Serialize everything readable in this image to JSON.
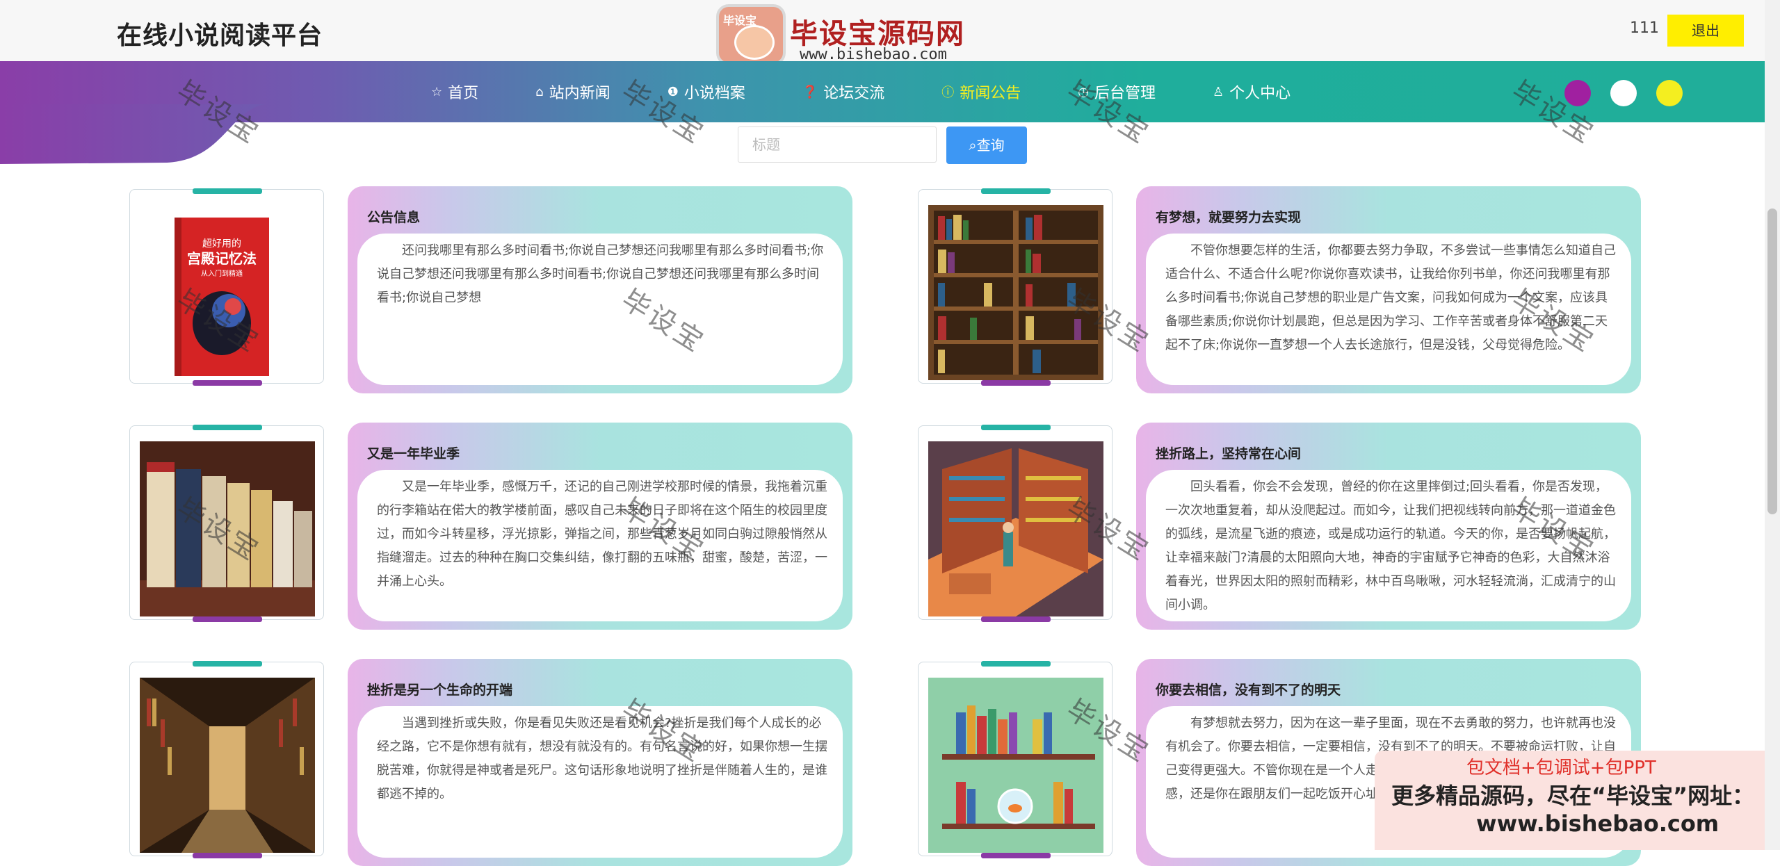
{
  "header": {
    "site_title": "在线小说阅读平台",
    "username": "111",
    "logout_label": "退出"
  },
  "watermark": {
    "badge_text": "毕设宝",
    "logo_text": "毕设宝源码网",
    "logo_url": "www.bishebao.com",
    "diagonal_text": "毕设宝"
  },
  "nav": {
    "items": [
      {
        "label": "首页",
        "icon": "star-icon"
      },
      {
        "label": "站内新闻",
        "icon": "bag-icon"
      },
      {
        "label": "小说档案",
        "icon": "info-icon"
      },
      {
        "label": "论坛交流",
        "icon": "question-icon"
      },
      {
        "label": "新闻公告",
        "icon": "info-icon",
        "active": true
      },
      {
        "label": "后台管理",
        "icon": "clock-icon"
      },
      {
        "label": "个人中心",
        "icon": "user-icon"
      }
    ],
    "theme_dots": [
      "#a020a0",
      "#ffffff",
      "#f4ee20"
    ]
  },
  "search": {
    "placeholder": "标题",
    "button_label": "查询"
  },
  "cards": [
    {
      "title": "公告信息",
      "content": "还问我哪里有那么多时间看书;你说自己梦想还问我哪里有那么多时间看书;你说自己梦想还问我哪里有那么多时间看书;你说自己梦想还问我哪里有那么多时间看书;你说自己梦想",
      "image": "book-cover-palace-memory",
      "image_caption": "超好用的 宫殿记忆法 从入门到精通"
    },
    {
      "title": "有梦想，就要努力去实现",
      "content": "不管你想要怎样的生活，你都要去努力争取，不多尝试一些事情怎么知道自己适合什么、不适合什么呢?你说你喜欢读书，让我给你列书单，你还问我哪里有那么多时间看书;你说自己梦想的职业是广告文案，问我如何成为一个文案，应该具备哪些素质;你说你计划晨跑，但总是因为学习、工作辛苦或者身体不舒服第二天起不了床;你说你一直梦想一个人去长途旅行，但是没钱，父母觉得危险。",
      "image": "bookshelf"
    },
    {
      "title": "又是一年毕业季",
      "content": "又是一年毕业季，感慨万千，还记的自己刚进学校那时候的情景，我拖着沉重的行李箱站在偌大的教学楼前面，感叹自己未来的日子即将在这个陌生的校园里度过，而如今斗转星移，浮光掠影，弹指之间，那些青葱岁月如同白驹过隙般悄然从指缝溜走。过去的种种在胸口交集纠结，像打翻的五味瓶，甜蜜，酸楚，苦涩，一并涌上心头。",
      "image": "book-boxes"
    },
    {
      "title": "挫折路上，坚持常在心间",
      "content": "回头看看，你会不会发现，曾经的你在这里摔倒过;回头看看，你是否发现，一次次地重复着，却从没爬起过。而如今，让我们把视线转向前方，那一道道金色的弧线，是流星飞逝的痕迹，或是成功运行的轨道。今天的你，是否要扬帆起航，让幸福来敲门?清晨的太阳照向大地，神奇的宇宙赋予它神奇的色彩，大自然沐浴着春光，世界因太阳的照射而精彩，林中百鸟啾啾，河水轻轻流淌，汇成清宁的山间小调。",
      "image": "library-illustration"
    },
    {
      "title": "挫折是另一个生命的开端",
      "content": "当遇到挫折或失败，你是看见失败还是看见机会?挫折是我们每个人成长的必经之路，它不是你想有就有，想没有就没有的。有句名言说的好，如果你想一生摆脱苦难，你就得是神或者是死尸。这句话形象地说明了挫折是伴随着人生的，是谁都逃不掉的。",
      "image": "library-aisle"
    },
    {
      "title": "你要去相信，没有到不了的明天",
      "content": "有梦想就去努力，因为在这一辈子里面，现在不去勇敢的努力，也许就再也没有机会了。你要去相信，一定要相信，没有到不了的明天。不要被命运打败，让自己变得更强大。不管你现在是一个人走在异乡的街道上，始终没有找到一丝归属感，还是你在跟朋友们一起吃饭开心址笑的时候闪过一丝落寞。",
      "image": "shelves-goldfish"
    }
  ],
  "promo": {
    "line1": "包文档+包调试+包PPT",
    "line2": "更多精品源码，尽在“毕设宝”网址：",
    "line3": "www.bishebao.com"
  }
}
